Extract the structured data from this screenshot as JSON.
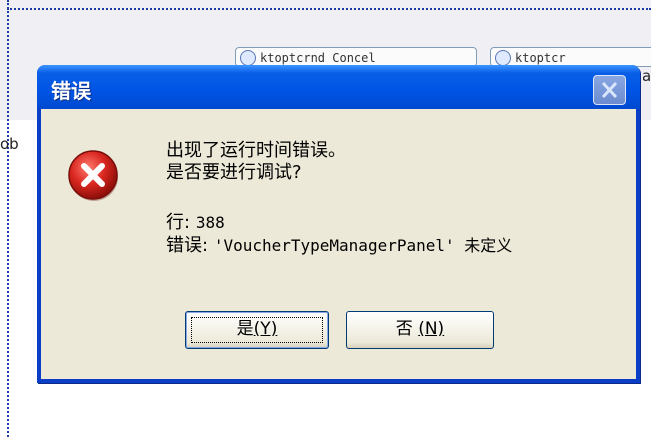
{
  "background": {
    "button1_text": "ktoptcrnd Concel",
    "button2_text": "ktoptcr",
    "left_fragment": "ob",
    "right_fragment": "a"
  },
  "dialog": {
    "title": "错误",
    "close_label": "×",
    "icon": "error-x-icon",
    "message_line1": "出现了运行时间错误。",
    "message_line2": "是否要进行调试?",
    "line_label": "行:",
    "line_value": "388",
    "error_label": "错误:",
    "error_detail": "'VoucherTypeManagerPanel' 未定义",
    "buttons": {
      "yes_label": "是",
      "yes_mnemonic": "(Y)",
      "no_label": "否",
      "no_mnemonic": "(N)"
    }
  },
  "colors": {
    "titlebar": "#0055e6",
    "dialog_body": "#ece9d8",
    "error_red": "#d8261f"
  }
}
